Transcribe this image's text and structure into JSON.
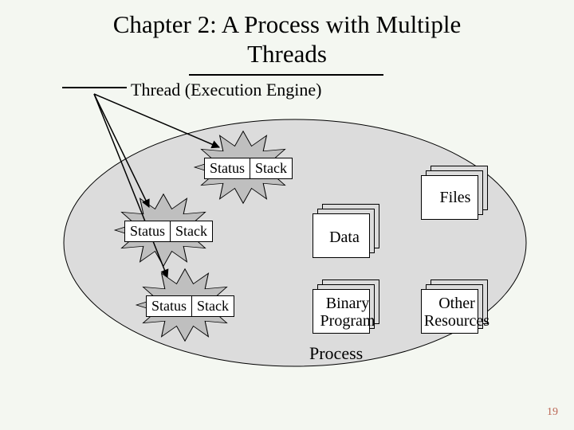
{
  "title_line1": "Chapter 2: A Process with Multiple",
  "title_line2": "Threads",
  "thread_label": "Thread (Execution Engine)",
  "thread_box": {
    "status": "Status",
    "stack": "Stack"
  },
  "shared": {
    "data": "Data",
    "files": "Files",
    "binary": "Binary Program",
    "other": "Other Resources"
  },
  "process_label": "Process",
  "page_number": "19",
  "chart_data": {
    "type": "diagram",
    "title": "A Process with Multiple Threads",
    "container": "Process",
    "threads": [
      {
        "status": "Status",
        "stack": "Stack"
      },
      {
        "status": "Status",
        "stack": "Stack"
      },
      {
        "status": "Status",
        "stack": "Stack"
      }
    ],
    "shared_resources": [
      "Data",
      "Files",
      "Binary Program",
      "Other Resources"
    ],
    "annotation": "Thread (Execution Engine) points to each thread's Status+Stack"
  }
}
